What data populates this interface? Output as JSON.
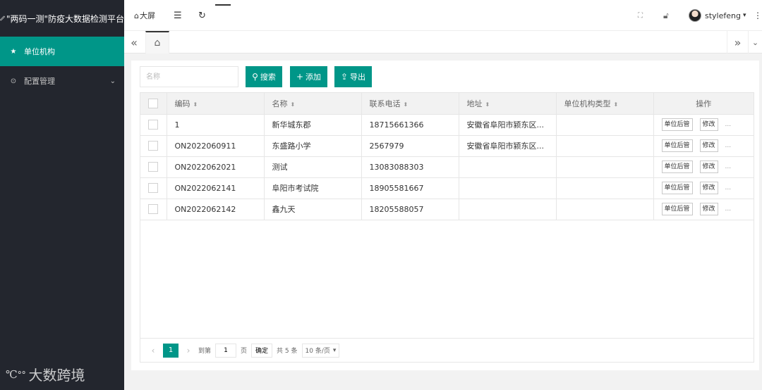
{
  "app": {
    "title": "\"两码一测\"防疫大数据检测平台"
  },
  "sidebar": {
    "items": [
      {
        "label": "单位机构",
        "icon": "star-icon",
        "active": true
      },
      {
        "label": "配置管理",
        "icon": "settings-icon",
        "active": false
      }
    ],
    "watermark": "大数跨境"
  },
  "header": {
    "bigscreen_label": "大屏",
    "username": "stylefeng"
  },
  "toolbar": {
    "name_placeholder": "名称",
    "search_label": "搜索",
    "add_label": "添加",
    "export_label": "导出"
  },
  "table": {
    "columns": [
      "编码",
      "名称",
      "联系电话",
      "地址",
      "单位机构类型",
      "操作"
    ],
    "rows": [
      {
        "code": "1",
        "name": "新华城东郡",
        "phone": "18715661366",
        "address": "安徽省阜阳市颍东区...",
        "type": ""
      },
      {
        "code": "ON2022060911",
        "name": "东盛路小学",
        "phone": "2567979",
        "address": "安徽省阜阳市颍东区...",
        "type": ""
      },
      {
        "code": "ON2022062021",
        "name": "测试",
        "phone": "13083088303",
        "address": "",
        "type": ""
      },
      {
        "code": "ON2022062141",
        "name": "阜阳市考试院",
        "phone": "18905581667",
        "address": "",
        "type": ""
      },
      {
        "code": "ON2022062142",
        "name": "鑫九天",
        "phone": "18205588057",
        "address": "",
        "type": ""
      }
    ],
    "row_actions": {
      "manage_label": "单位后管",
      "edit_label": "修改",
      "more_label": "..."
    }
  },
  "pager": {
    "current_page": "1",
    "goto_label": "到第",
    "goto_value": "1",
    "page_unit": "页",
    "confirm_label": "确定",
    "total_label": "共 5 条",
    "page_size_label": "10 条/页"
  },
  "colors": {
    "accent": "#009688",
    "sidebar_bg": "#23262e"
  }
}
